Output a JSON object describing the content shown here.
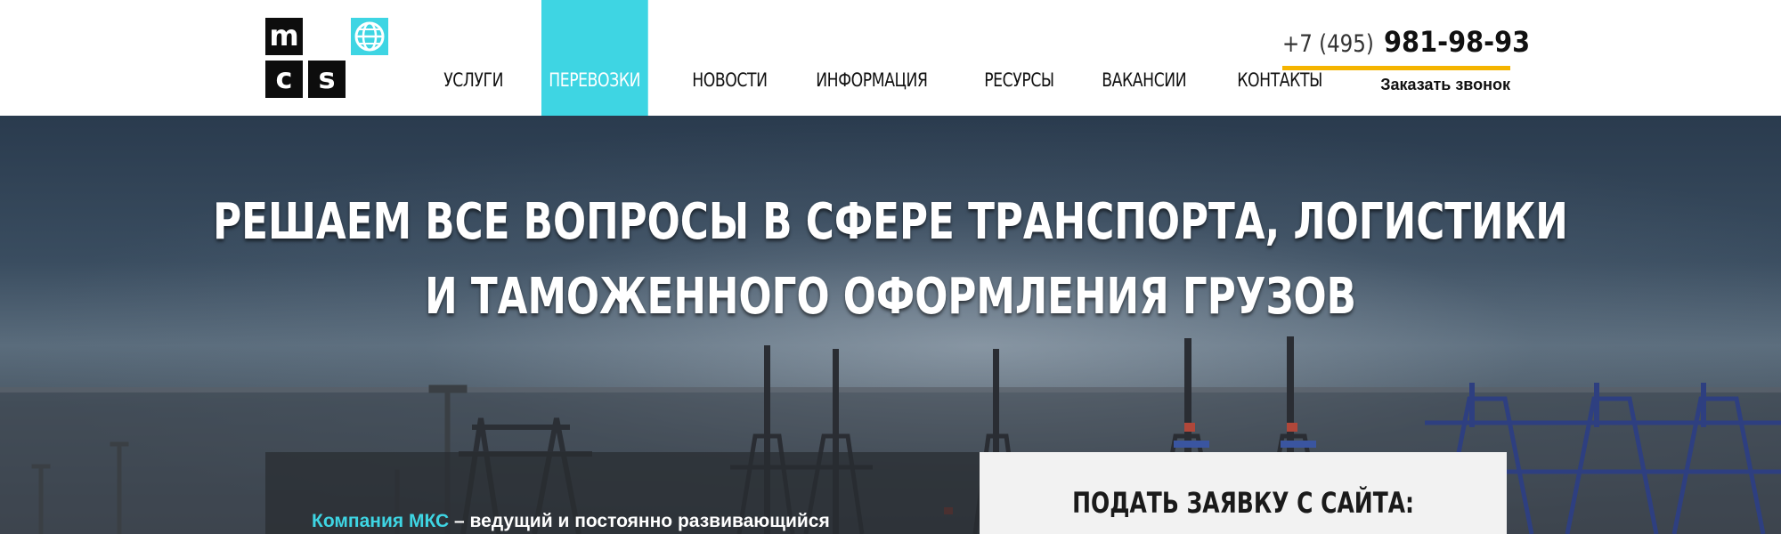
{
  "header": {
    "logo": {
      "letters": [
        "m",
        "",
        "c",
        "s"
      ],
      "globe_icon": "globe-icon"
    },
    "nav": [
      {
        "label": "УСЛУГИ",
        "active": false
      },
      {
        "label": "ПЕРЕВОЗКИ",
        "active": true
      },
      {
        "label": "НОВОСТИ",
        "active": false
      },
      {
        "label": "ИНФОРМАЦИЯ",
        "active": false
      },
      {
        "label": "РЕСУРСЫ",
        "active": false
      },
      {
        "label": "ВАКАНСИИ",
        "active": false
      },
      {
        "label": "КОНТАКТЫ",
        "active": false
      }
    ],
    "phone": {
      "code": "+7 (495)",
      "number": "981-98-93"
    },
    "callback_label": "Заказать звонок"
  },
  "hero": {
    "title_line1": "РЕШАЕМ ВСЕ ВОПРОСЫ В СФЕРЕ ТРАНСПОРТА, ЛОГИСТИКИ",
    "title_line2": "И ТАМОЖЕННОГО ОФОРМЛЕНИЯ ГРУЗОВ",
    "about": {
      "company": "Компания МКС",
      "text": " – ведущий и постоянно развивающийся"
    },
    "request_title": "ПОДАТЬ ЗАЯВКУ С САЙТА:"
  },
  "colors": {
    "accent": "#3ed5e3",
    "phone_underline": "#f5b400",
    "header_bg": "#ffffff"
  }
}
